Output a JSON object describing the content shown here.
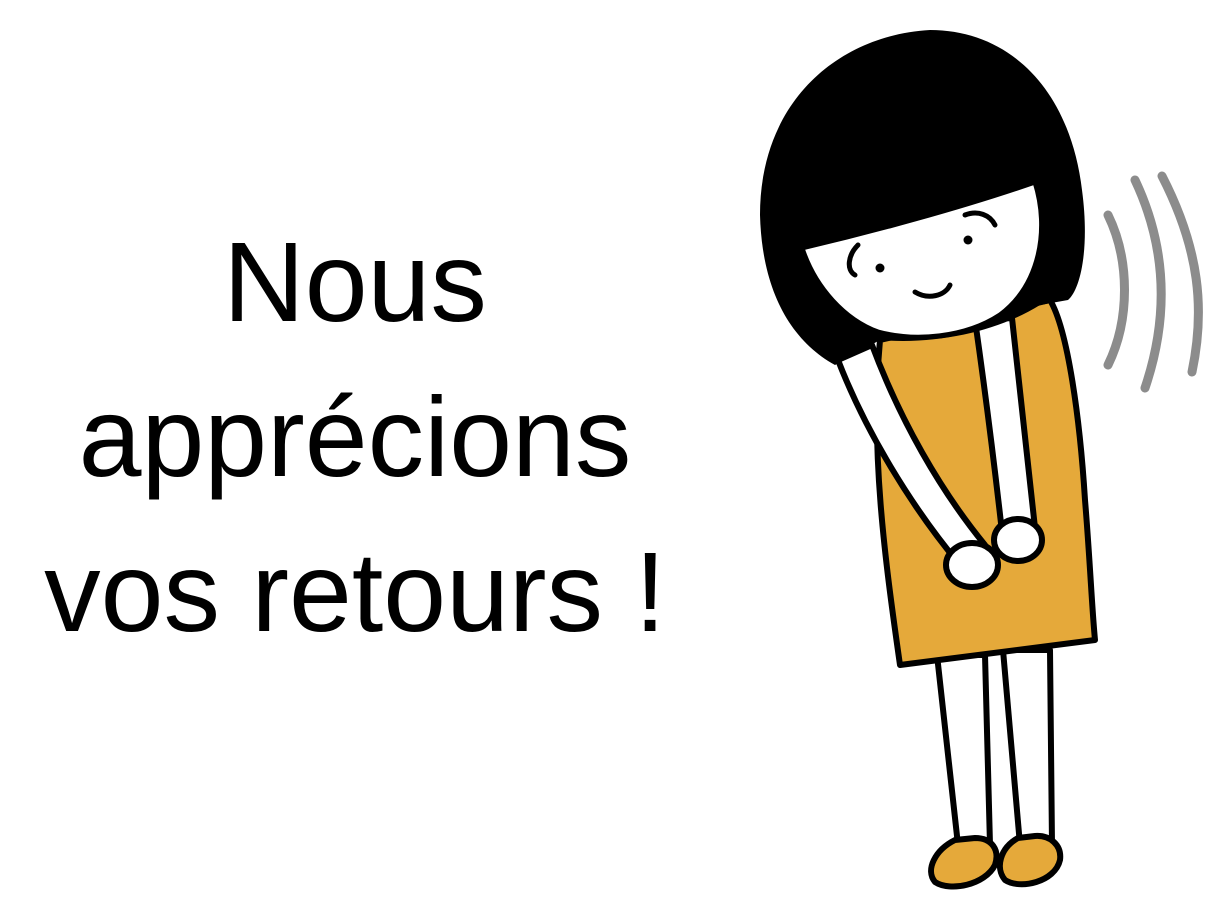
{
  "message": {
    "line1": "Nous",
    "line2": "apprécions",
    "line3": "vos retours !"
  },
  "illustration": {
    "icon": "bowing-girl-icon",
    "colors": {
      "hair": "#000000",
      "dress": "#E5A93A",
      "shoes": "#E5A93A",
      "motion_lines": "#8C8C8C",
      "outline": "#000000"
    }
  }
}
